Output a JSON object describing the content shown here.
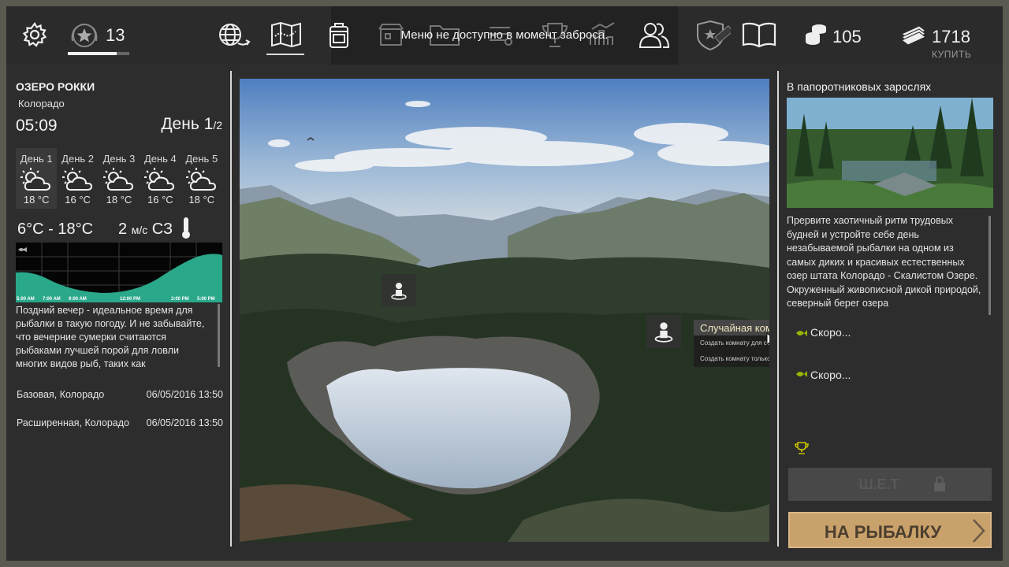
{
  "topbar": {
    "rank": "13",
    "rank_progress": 0.8,
    "message": "Меню не доступно в момент заброса.",
    "coins": "105",
    "money": "1718",
    "buy_label": "КУПИТЬ",
    "icons": [
      "gear-icon",
      "rank-star-icon",
      "globe-travel-icon",
      "map-icon",
      "backpack-icon",
      "shop-icon",
      "folder-icon",
      "gear-list-icon",
      "trophy-icon",
      "stats-icon",
      "friends-icon",
      "premium-shield-icon",
      "book-icon",
      "coins-icon",
      "cash-icon"
    ]
  },
  "location": {
    "name": "ОЗЕРО РОККИ",
    "region": "Колорадо",
    "time": "05:09",
    "day_label": "День",
    "day_current": "1",
    "day_total": "/2"
  },
  "forecast": [
    {
      "label": "День 1",
      "temp": "18 °C",
      "icon": "partly-cloudy-icon"
    },
    {
      "label": "День 2",
      "temp": "16 °C",
      "icon": "partly-cloudy-icon"
    },
    {
      "label": "День 3",
      "temp": "18 °C",
      "icon": "partly-cloudy-icon"
    },
    {
      "label": "День 4",
      "temp": "16 °C",
      "icon": "partly-cloudy-icon"
    },
    {
      "label": "День 5",
      "temp": "18 °C",
      "icon": "partly-cloudy-icon"
    }
  ],
  "conditions": {
    "temp_range": "6°C - 18°C",
    "wind_speed": "2",
    "wind_unit": "м/с",
    "wind_dir": "СЗ"
  },
  "activity_graph": {
    "time_labels": [
      "5:00 AM",
      "7:00 AM",
      "9:00 AM",
      "12:00 PM",
      "3:00 PM",
      "5:00 PM"
    ],
    "colors": {
      "fill": "#2aa88a",
      "background": "#050505"
    }
  },
  "hint_text": "Поздний вечер - идеальное время для рыбалки в такую погоду.  И не забывайте, что вечерние сумерки считаются рыбаками лучшей порой для ловли многих видов рыб, таких как",
  "licenses": [
    {
      "name": "Базовая, Колорадо",
      "date": "06/05/2016 13:50"
    },
    {
      "name": "Расширенная, Колорадо",
      "date": "06/05/2016 13:50"
    }
  ],
  "room_menu": {
    "random_room": "Случайная комната",
    "friends_room": "Создать комнату для себя и друзей",
    "private_room": "Создать комнату только для себя"
  },
  "spot": {
    "title": "В папоротниковых зарослях",
    "description": "Прервите хаотичный ритм трудовых будней и устройте себе день незабываемой рыбалки на одном из самых диких и красивых естественных озер штата Колорадо - Скалистом Озере. Окруженный живописной дикой природой, северный берег озера",
    "soon_items": [
      "Скоро...",
      "Скоро..."
    ]
  },
  "buttons": {
    "locked_label": "Ш.Е.Т",
    "go_fishing": "НА РЫБАЛКУ"
  },
  "colors": {
    "accent": "#c9a16a",
    "accent_text": "#4c3f2f",
    "menu_highlight_text": "#f2e6c0",
    "trophy": "#c8c000"
  }
}
